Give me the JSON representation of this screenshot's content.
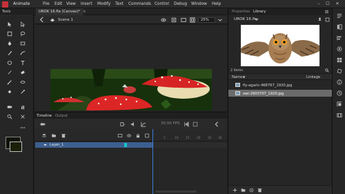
{
  "menubar": {
    "app_name": "Animate",
    "items": [
      "File",
      "Edit",
      "View",
      "Insert",
      "Modify",
      "Text",
      "Commands",
      "Control",
      "Debug",
      "Window",
      "Help"
    ],
    "min": "–",
    "max": "☐",
    "close": "✕"
  },
  "tools": {
    "title": "Tools"
  },
  "document": {
    "tab_title": "UROK 16.fla (Canvas)*",
    "tab_close": "×",
    "scene": "Scene 1",
    "zoom": "25%"
  },
  "timeline": {
    "tab_timeline": "Timeline",
    "tab_output": "Output",
    "fps": "30.00",
    "fps_unit": "FPS",
    "layer_name": "Layer_1",
    "ruler": [
      "5",
      "10",
      "15",
      "20",
      "25",
      "30"
    ]
  },
  "library": {
    "tab_properties": "Properties",
    "tab_library": "Library",
    "document": "UROK 16.fla",
    "item_count": "2 items",
    "col_name": "Name",
    "col_linkage": "Linkage",
    "items": [
      {
        "name": "fly-agaric-468767_1920.jpg",
        "selected": false
      },
      {
        "name": "owl-2903707_1920.jpg",
        "selected": true
      }
    ]
  },
  "colors": {
    "accent_layer": "#3c5f8f",
    "keyframe": "#14c6c6",
    "playhead": "#3b7ddb",
    "brand": "#c7323a"
  }
}
